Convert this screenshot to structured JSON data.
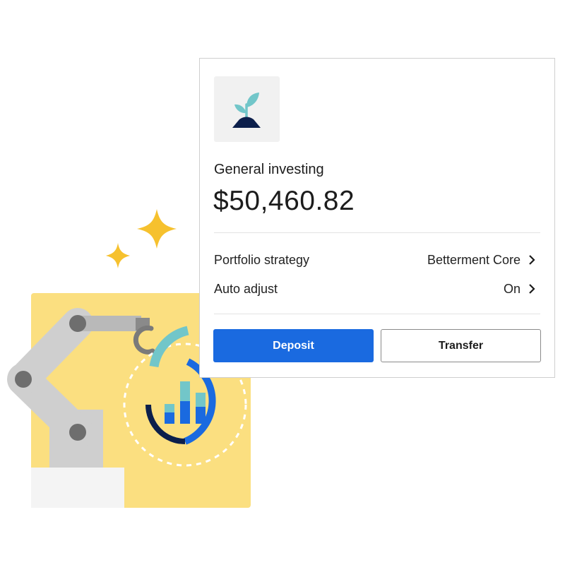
{
  "account": {
    "icon": "seedling-icon",
    "name": "General investing",
    "balance": "$50,460.82"
  },
  "details": [
    {
      "label": "Portfolio strategy",
      "value": "Betterment Core"
    },
    {
      "label": "Auto adjust",
      "value": "On"
    }
  ],
  "actions": {
    "deposit_label": "Deposit",
    "transfer_label": "Transfer"
  },
  "colors": {
    "brand_blue": "#1a6ae0",
    "illustration_yellow": "#fbdf80",
    "sparkle_yellow": "#f6c12e",
    "teal": "#72c6c9",
    "navy": "#0c1f4b"
  },
  "illustration": {
    "icons": [
      "sparkle-icon",
      "robot-arm-icon",
      "bar-chart-icon"
    ]
  }
}
